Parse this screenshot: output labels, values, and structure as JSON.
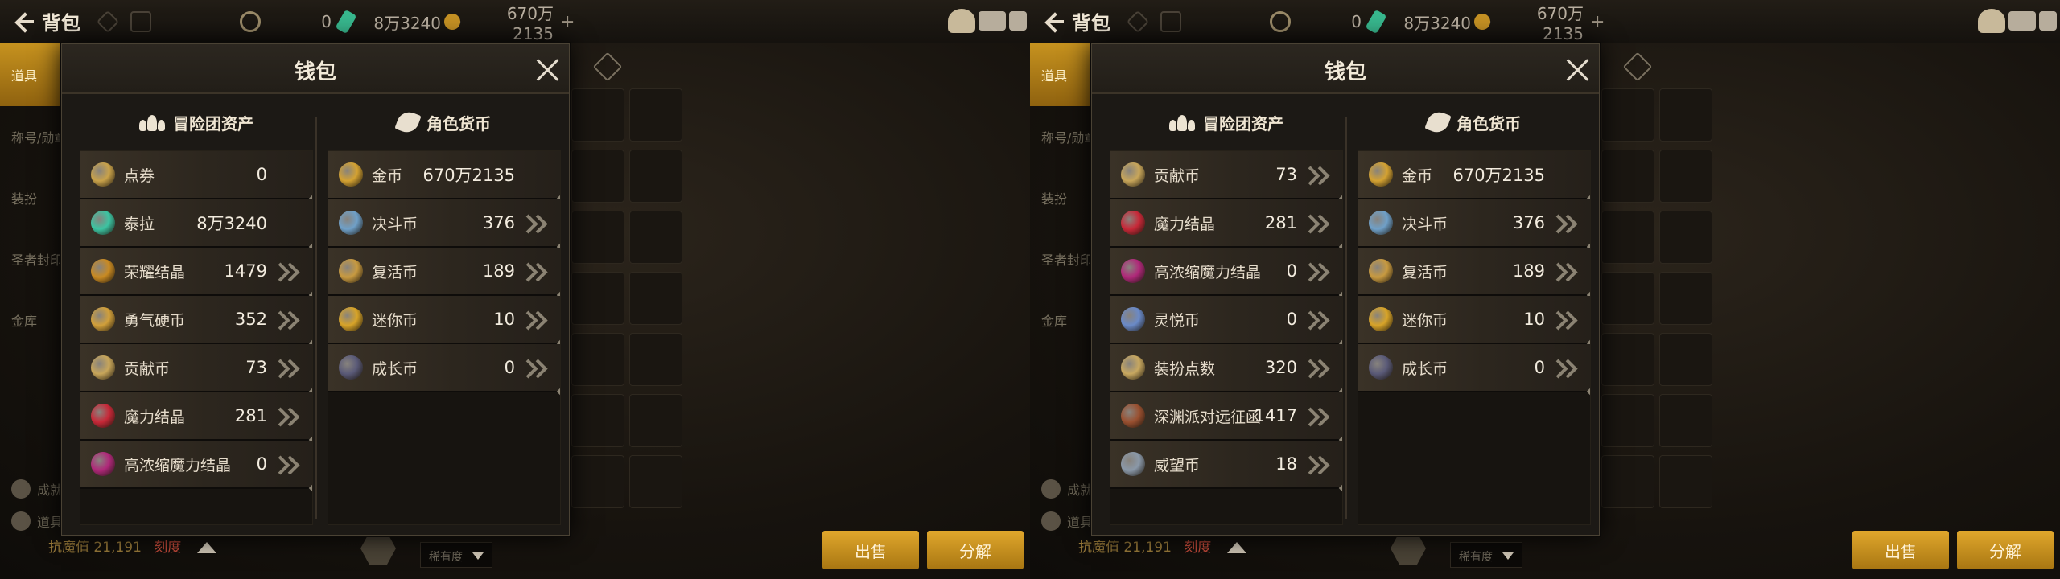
{
  "screens": [
    {
      "topbar": {
        "title": "背包",
        "tera": "0",
        "cera": "8万3240",
        "gold": "670万2135"
      },
      "nav": [
        "道具",
        "称号/勋章",
        "装扮",
        "圣者封印",
        "金库"
      ],
      "nav_footer": [
        "成就仓库",
        "道具辞典"
      ],
      "bottom": {
        "stat_label": "抗魔值",
        "stat_value": "21,191",
        "stat_sword": "刻度",
        "select": "稀有度",
        "btn_sell": "出售",
        "btn_decompose": "分解"
      },
      "wallet": {
        "title": "钱包",
        "left_title": "冒险团资产",
        "right_title": "角色货币",
        "left_items": [
          {
            "name": "点券",
            "value": "0",
            "icon": "cera-point-icon",
            "color": "#c9a24a",
            "arrow": false
          },
          {
            "name": "泰拉",
            "value": "8万3240",
            "icon": "tera-crystal-icon",
            "color": "#3cc4a2",
            "arrow": false
          },
          {
            "name": "荣耀结晶",
            "value": "1479",
            "icon": "trophy-icon",
            "color": "#c98a22",
            "arrow": true
          },
          {
            "name": "勇气硬币",
            "value": "352",
            "icon": "courage-coin-icon",
            "color": "#d2a03a",
            "arrow": true
          },
          {
            "name": "贡献币",
            "value": "73",
            "icon": "contribution-coin-icon",
            "color": "#c8a65a",
            "arrow": true
          },
          {
            "name": "魔力结晶",
            "value": "281",
            "icon": "mana-crystal-icon",
            "color": "#c82838",
            "arrow": true
          },
          {
            "name": "高浓缩魔力结晶",
            "value": "0",
            "icon": "condensed-crystal-icon",
            "color": "#b0287a",
            "arrow": true
          }
        ],
        "right_items": [
          {
            "name": "金币",
            "value": "670万2135",
            "icon": "gold-coin-icon",
            "color": "#d4a232",
            "arrow": false
          },
          {
            "name": "决斗币",
            "value": "376",
            "icon": "duel-coin-icon",
            "color": "#6fa0c8",
            "arrow": true
          },
          {
            "name": "复活币",
            "value": "189",
            "icon": "revive-coin-icon",
            "color": "#c89a40",
            "arrow": true
          },
          {
            "name": "迷你币",
            "value": "10",
            "icon": "mini-coin-icon",
            "color": "#d8a428",
            "arrow": true
          },
          {
            "name": "成长币",
            "value": "0",
            "icon": "growth-coin-icon",
            "color": "#5a5a78",
            "arrow": true
          }
        ]
      }
    },
    {
      "topbar": {
        "title": "背包",
        "tera": "0",
        "cera": "8万3240",
        "gold": "670万2135"
      },
      "nav": [
        "道具",
        "称号/勋章",
        "装扮",
        "圣者封印",
        "金库"
      ],
      "nav_footer": [
        "成就仓库",
        "道具辞典"
      ],
      "bottom": {
        "stat_label": "抗魔值",
        "stat_value": "21,191",
        "stat_sword": "刻度",
        "select": "稀有度",
        "btn_sell": "出售",
        "btn_decompose": "分解"
      },
      "wallet": {
        "title": "钱包",
        "left_title": "冒险团资产",
        "right_title": "角色货币",
        "left_items": [
          {
            "name": "贡献币",
            "value": "73",
            "icon": "contribution-coin-icon",
            "color": "#c8a65a",
            "arrow": true
          },
          {
            "name": "魔力结晶",
            "value": "281",
            "icon": "mana-crystal-icon",
            "color": "#c82838",
            "arrow": true
          },
          {
            "name": "高浓缩魔力结晶",
            "value": "0",
            "icon": "condensed-crystal-icon",
            "color": "#b0287a",
            "arrow": true
          },
          {
            "name": "灵悦币",
            "value": "0",
            "icon": "spirit-coin-icon",
            "color": "#6a8ac8",
            "arrow": true
          },
          {
            "name": "装扮点数",
            "value": "320",
            "icon": "avatar-point-icon",
            "color": "#c8a860",
            "arrow": true
          },
          {
            "name": "深渊派对远征函",
            "value": "1417",
            "icon": "abyss-ticket-icon",
            "color": "#9a5030",
            "arrow": true
          },
          {
            "name": "威望币",
            "value": "18",
            "icon": "prestige-coin-icon",
            "color": "#8a98a8",
            "arrow": true
          }
        ],
        "right_items": [
          {
            "name": "金币",
            "value": "670万2135",
            "icon": "gold-coin-icon",
            "color": "#d4a232",
            "arrow": false
          },
          {
            "name": "决斗币",
            "value": "376",
            "icon": "duel-coin-icon",
            "color": "#6fa0c8",
            "arrow": true
          },
          {
            "name": "复活币",
            "value": "189",
            "icon": "revive-coin-icon",
            "color": "#c89a40",
            "arrow": true
          },
          {
            "name": "迷你币",
            "value": "10",
            "icon": "mini-coin-icon",
            "color": "#d8a428",
            "arrow": true
          },
          {
            "name": "成长币",
            "value": "0",
            "icon": "growth-coin-icon",
            "color": "#5a5a78",
            "arrow": true
          }
        ]
      }
    }
  ]
}
